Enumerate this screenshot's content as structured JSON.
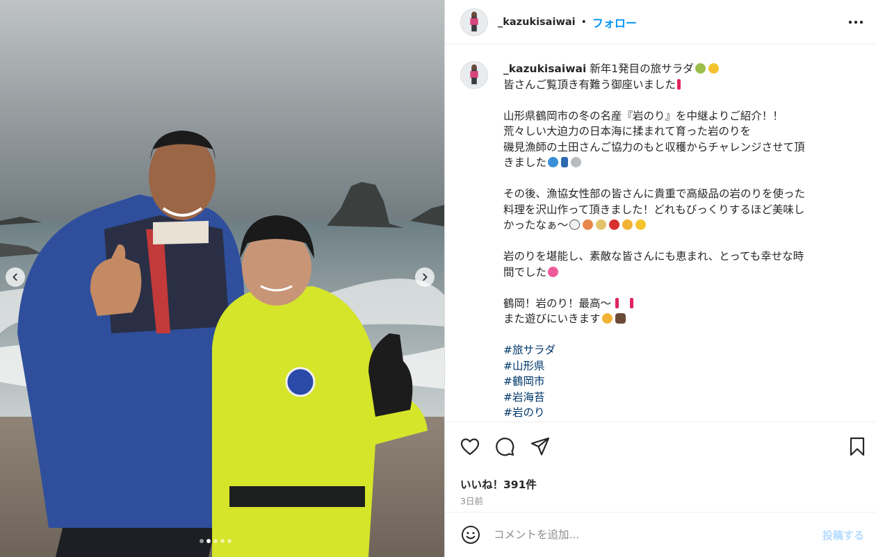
{
  "post": {
    "username": "_kazukisaiwai",
    "follow_label": "フォロー",
    "header_separator": "•",
    "more_icon": "more-horizontal-icon",
    "caption_lines": [
      "新年1発目の旅サラダ",
      "皆さんご覧頂き有難う御座いました",
      "",
      "山形県鶴岡市の冬の名産『岩のり』を中継よりご紹介！！",
      "荒々しい大迫力の日本海に揉まれて育った岩のりを",
      "磯見漁師の土田さんご協力のもと収穫からチャレンジさせて頂",
      "きました",
      "",
      "その後、漁協女性部の皆さんに貴重で高級品の岩のりを使った",
      "料理を沢山作って頂きました！どれもびっくりするほど美味し",
      "かったなぁ〜",
      "",
      "岩のりを堪能し、素敵な皆さんにも恵まれ、とっても幸せな時",
      "間でした",
      "",
      "鶴岡！岩のり！最高〜",
      "また遊びにいきます"
    ],
    "hashtags": [
      "#旅サラダ",
      "#山形県",
      "#鶴岡市",
      "#岩海苔",
      "#岩のり"
    ],
    "likes": "いいね！391件",
    "time_ago": "3日前",
    "comment_placeholder": "コメントを追加...",
    "post_button": "投稿する"
  },
  "carousel": {
    "slide_count": 5,
    "active_index": 1
  },
  "colors": {
    "link_blue": "#0095f6",
    "hashtag_blue": "#00376b",
    "post_disabled": "#b3dbff",
    "jacket_blue": "#2f4f9c",
    "jacket_yellow": "#d4e52a"
  }
}
